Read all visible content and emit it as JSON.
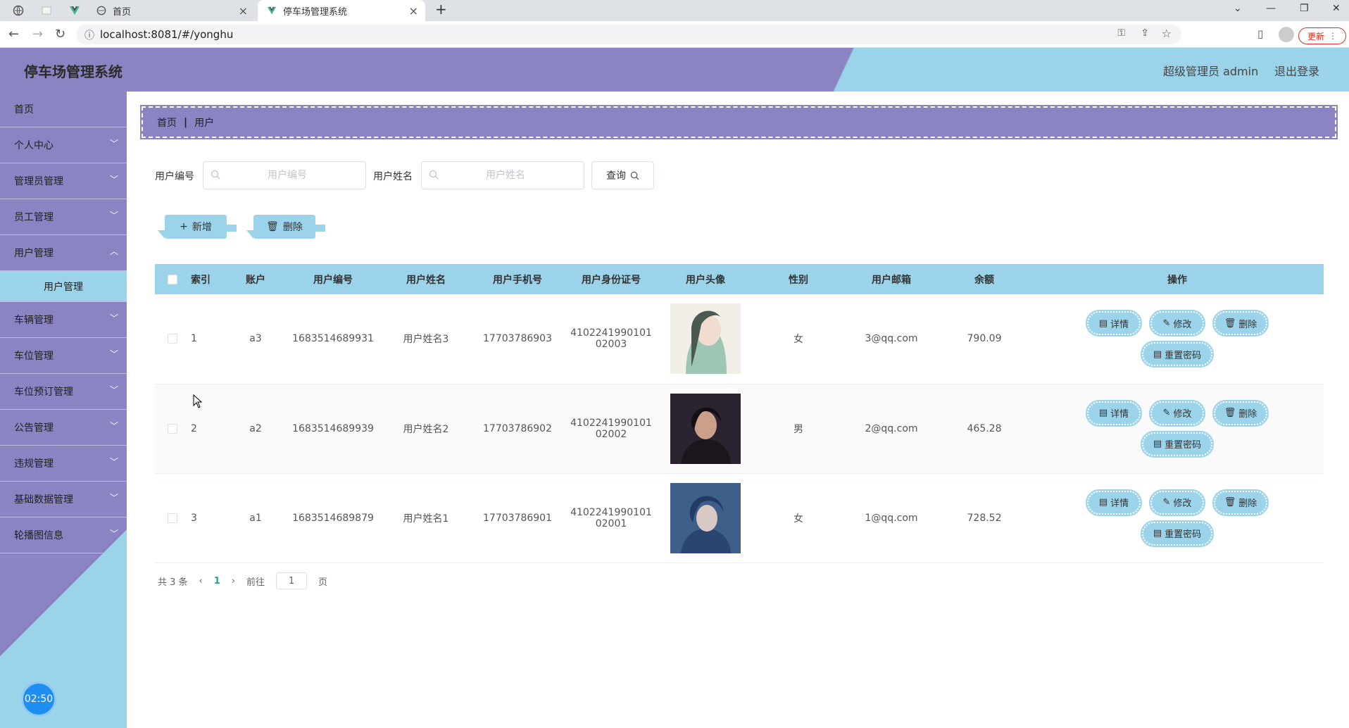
{
  "browser": {
    "tabs": [
      {
        "label": "首页"
      },
      {
        "label": "停车场管理系统"
      }
    ],
    "url": "localhost:8081/#/yonghu",
    "update_label": "更新"
  },
  "header": {
    "title": "停车场管理系统",
    "user": "超级管理员 admin",
    "logout": "退出登录"
  },
  "sidebar": {
    "items": [
      {
        "label": "首页"
      },
      {
        "label": "个人中心"
      },
      {
        "label": "管理员管理"
      },
      {
        "label": "员工管理"
      },
      {
        "label": "用户管理"
      },
      {
        "label": "用户管理"
      },
      {
        "label": "车辆管理"
      },
      {
        "label": "车位管理"
      },
      {
        "label": "车位预订管理"
      },
      {
        "label": "公告管理"
      },
      {
        "label": "违规管理"
      },
      {
        "label": "基础数据管理"
      },
      {
        "label": "轮播图信息"
      }
    ],
    "clock": "02:50"
  },
  "breadcrumb": {
    "home": "首页",
    "sep": "|",
    "current": "用户"
  },
  "search": {
    "code_label": "用户编号",
    "code_placeholder": "用户编号",
    "name_label": "用户姓名",
    "name_placeholder": "用户姓名",
    "query_label": "查询"
  },
  "actions": {
    "add": "新增",
    "delete": "删除"
  },
  "table": {
    "headers": [
      "索引",
      "账户",
      "用户编号",
      "用户姓名",
      "用户手机号",
      "用户身份证号",
      "用户头像",
      "性别",
      "用户邮箱",
      "余额",
      "操作"
    ],
    "rows": [
      {
        "index": "1",
        "account": "a3",
        "code": "1683514689931",
        "name": "用户姓名3",
        "phone": "17703786903",
        "id1": "4102241990101",
        "id2": "02003",
        "gender": "女",
        "email": "3@qq.com",
        "balance": "790.09"
      },
      {
        "index": "2",
        "account": "a2",
        "code": "1683514689939",
        "name": "用户姓名2",
        "phone": "17703786902",
        "id1": "4102241990101",
        "id2": "02002",
        "gender": "男",
        "email": "2@qq.com",
        "balance": "465.28"
      },
      {
        "index": "3",
        "account": "a1",
        "code": "1683514689879",
        "name": "用户姓名1",
        "phone": "17703786901",
        "id1": "4102241990101",
        "id2": "02001",
        "gender": "女",
        "email": "1@qq.com",
        "balance": "728.52"
      }
    ],
    "ops": {
      "detail": "详情",
      "edit": "修改",
      "delete": "删除",
      "reset": "重置密码"
    }
  },
  "pagination": {
    "total": "共 3 条",
    "page": "1",
    "goto": "前往",
    "page_input": "1",
    "page_unit": "页"
  }
}
